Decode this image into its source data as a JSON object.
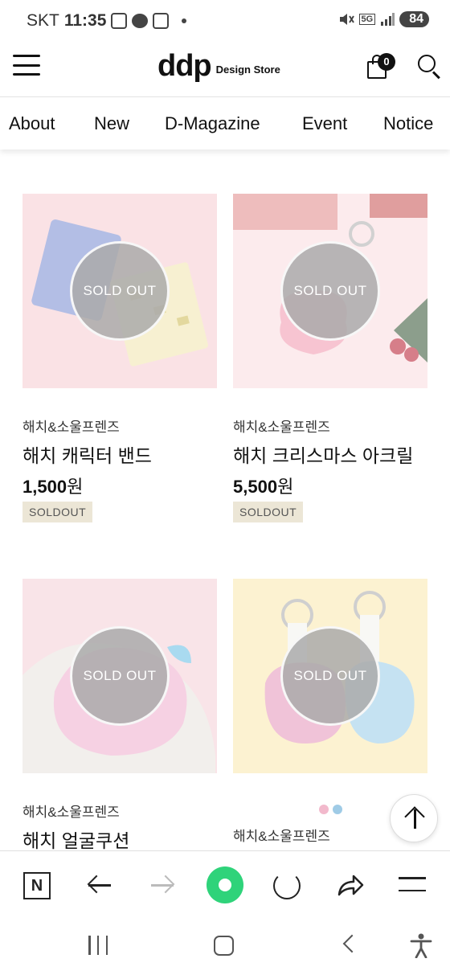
{
  "status_bar": {
    "carrier": "SKT",
    "time": "11:35",
    "network": "5G",
    "battery": "84"
  },
  "header": {
    "logo": "ddp",
    "logo_sub": "Design Store",
    "cart_count": "0"
  },
  "nav": {
    "items": [
      "About",
      "New",
      "D-Magazine",
      "Event",
      "Notice"
    ]
  },
  "products": [
    {
      "brand": "해치&소울프렌즈",
      "name": "해치 캐릭터 밴드",
      "price": "1,500",
      "unit": "원",
      "badge": "SOLDOUT",
      "overlay": "SOLD OUT",
      "bg": "#f7d3d8"
    },
    {
      "brand": "해치&소울프렌즈",
      "name": "해치 크리스마스 아크릴",
      "price": "5,500",
      "unit": "원",
      "badge": "SOLDOUT",
      "overlay": "SOLD OUT",
      "bg": "#fbe0e3"
    },
    {
      "brand": "해치&소울프렌즈",
      "name": "해치 얼굴쿠션",
      "overlay": "SOLD OUT",
      "bg": "#f6d6dc"
    },
    {
      "brand": "해치&소울프렌즈",
      "overlay": "SOLD OUT",
      "bg": "#fbecb8",
      "color_dots": [
        "#f2b9cc",
        "#9fcbe6"
      ]
    }
  ],
  "colors": {
    "soldout_badge_bg": "#ece6d6",
    "home_button": "#2fd37a"
  },
  "toolbar": {
    "n_label": "N"
  }
}
